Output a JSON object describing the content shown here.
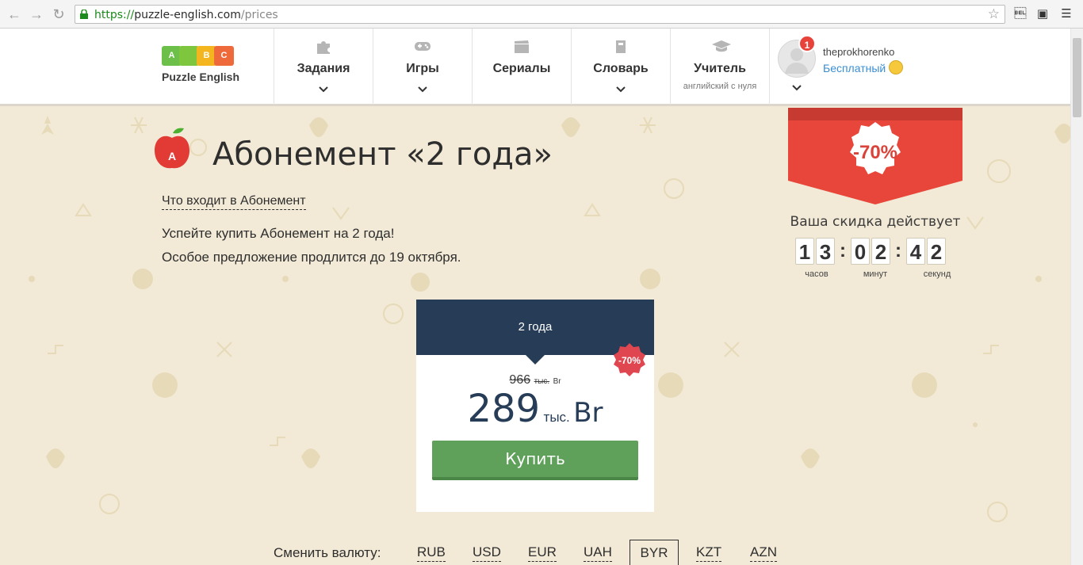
{
  "browser": {
    "url_scheme": "https://",
    "url_host": "puzzle-english.com",
    "url_path": "/prices"
  },
  "header": {
    "logo_letters": [
      "A",
      "B",
      "C"
    ],
    "logo_text": "Puzzle English",
    "menu": [
      {
        "label": "Задания",
        "icon": "puzzle-icon",
        "has_dropdown": true
      },
      {
        "label": "Игры",
        "icon": "gamepad-icon",
        "has_dropdown": true
      },
      {
        "label": "Сериалы",
        "icon": "clapperboard-icon",
        "has_dropdown": false
      },
      {
        "label": "Словарь",
        "icon": "book-icon",
        "has_dropdown": true
      },
      {
        "label": "Учитель",
        "sub": "английский с нуля",
        "icon": "graduation-cap-icon",
        "has_dropdown": false
      }
    ],
    "user": {
      "notifications": "1",
      "username": "theprokhorenko",
      "plan": "Бесплатный"
    }
  },
  "main": {
    "title": "Абонемент «2 года»",
    "what_included_link": "Что входит в Абонемент",
    "offer_line1": "Успейте купить Абонемент на 2 года!",
    "offer_line2": "Особое предложение продлится до 19 октября."
  },
  "promo": {
    "discount": "-70%",
    "discount_label": "Ваша скидка действует",
    "timer": {
      "hours": [
        "1",
        "3"
      ],
      "minutes": [
        "0",
        "2"
      ],
      "seconds": [
        "4",
        "2"
      ],
      "hours_label": "часов",
      "minutes_label": "минут",
      "seconds_label": "секунд"
    }
  },
  "card": {
    "period": "2 года",
    "badge": "-70%",
    "old_price": "966",
    "old_price_unit": "тыс.",
    "old_price_currency": "Br",
    "new_price": "289",
    "new_price_unit": "тыс.",
    "new_price_currency": "Br",
    "buy_label": "Купить"
  },
  "currency": {
    "label": "Сменить валюту:",
    "options": [
      "RUB",
      "USD",
      "EUR",
      "UAH",
      "BYR",
      "KZT",
      "AZN"
    ],
    "selected": "BYR"
  },
  "colors": {
    "page_bg": "#f2ead6",
    "card_header": "#263c57",
    "buy_button": "#5fa05a",
    "ribbon_red": "#e8463a",
    "link_blue": "#3a8fd3"
  }
}
